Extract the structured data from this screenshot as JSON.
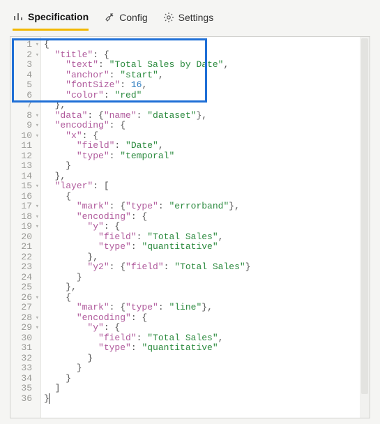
{
  "tabs": {
    "specification": "Specification",
    "config": "Config",
    "settings": "Settings",
    "activeIndex": 0
  },
  "gutter": {
    "count": 36,
    "foldLines": [
      1,
      2,
      8,
      9,
      10,
      15,
      17,
      18,
      19,
      26,
      28,
      29
    ]
  },
  "code": {
    "lines": [
      [
        {
          "t": "p",
          "v": "{"
        }
      ],
      [
        {
          "t": "sp",
          "v": "  "
        },
        {
          "t": "k",
          "v": "\"title\""
        },
        {
          "t": "p",
          "v": ": {"
        }
      ],
      [
        {
          "t": "sp",
          "v": "    "
        },
        {
          "t": "k",
          "v": "\"text\""
        },
        {
          "t": "p",
          "v": ": "
        },
        {
          "t": "s",
          "v": "\"Total Sales by Date\""
        },
        {
          "t": "p",
          "v": ","
        }
      ],
      [
        {
          "t": "sp",
          "v": "    "
        },
        {
          "t": "k",
          "v": "\"anchor\""
        },
        {
          "t": "p",
          "v": ": "
        },
        {
          "t": "s",
          "v": "\"start\""
        },
        {
          "t": "p",
          "v": ","
        }
      ],
      [
        {
          "t": "sp",
          "v": "    "
        },
        {
          "t": "k",
          "v": "\"fontSize\""
        },
        {
          "t": "p",
          "v": ": "
        },
        {
          "t": "n",
          "v": "16"
        },
        {
          "t": "p",
          "v": ","
        }
      ],
      [
        {
          "t": "sp",
          "v": "    "
        },
        {
          "t": "k",
          "v": "\"color\""
        },
        {
          "t": "p",
          "v": ": "
        },
        {
          "t": "s",
          "v": "\"red\""
        }
      ],
      [
        {
          "t": "sp",
          "v": "  "
        },
        {
          "t": "p",
          "v": "},"
        }
      ],
      [
        {
          "t": "sp",
          "v": "  "
        },
        {
          "t": "k",
          "v": "\"data\""
        },
        {
          "t": "p",
          "v": ": {"
        },
        {
          "t": "k",
          "v": "\"name\""
        },
        {
          "t": "p",
          "v": ": "
        },
        {
          "t": "s",
          "v": "\"dataset\""
        },
        {
          "t": "p",
          "v": "},"
        }
      ],
      [
        {
          "t": "sp",
          "v": "  "
        },
        {
          "t": "k",
          "v": "\"encoding\""
        },
        {
          "t": "p",
          "v": ": {"
        }
      ],
      [
        {
          "t": "sp",
          "v": "    "
        },
        {
          "t": "k",
          "v": "\"x\""
        },
        {
          "t": "p",
          "v": ": {"
        }
      ],
      [
        {
          "t": "sp",
          "v": "      "
        },
        {
          "t": "k",
          "v": "\"field\""
        },
        {
          "t": "p",
          "v": ": "
        },
        {
          "t": "s",
          "v": "\"Date\""
        },
        {
          "t": "p",
          "v": ","
        }
      ],
      [
        {
          "t": "sp",
          "v": "      "
        },
        {
          "t": "k",
          "v": "\"type\""
        },
        {
          "t": "p",
          "v": ": "
        },
        {
          "t": "s",
          "v": "\"temporal\""
        }
      ],
      [
        {
          "t": "sp",
          "v": "    "
        },
        {
          "t": "p",
          "v": "}"
        }
      ],
      [
        {
          "t": "sp",
          "v": "  "
        },
        {
          "t": "p",
          "v": "},"
        }
      ],
      [
        {
          "t": "sp",
          "v": "  "
        },
        {
          "t": "k",
          "v": "\"layer\""
        },
        {
          "t": "p",
          "v": ": ["
        }
      ],
      [
        {
          "t": "sp",
          "v": "    "
        },
        {
          "t": "p",
          "v": "{"
        }
      ],
      [
        {
          "t": "sp",
          "v": "      "
        },
        {
          "t": "k",
          "v": "\"mark\""
        },
        {
          "t": "p",
          "v": ": {"
        },
        {
          "t": "k",
          "v": "\"type\""
        },
        {
          "t": "p",
          "v": ": "
        },
        {
          "t": "s",
          "v": "\"errorband\""
        },
        {
          "t": "p",
          "v": "},"
        }
      ],
      [
        {
          "t": "sp",
          "v": "      "
        },
        {
          "t": "k",
          "v": "\"encoding\""
        },
        {
          "t": "p",
          "v": ": {"
        }
      ],
      [
        {
          "t": "sp",
          "v": "        "
        },
        {
          "t": "k",
          "v": "\"y\""
        },
        {
          "t": "p",
          "v": ": {"
        }
      ],
      [
        {
          "t": "sp",
          "v": "          "
        },
        {
          "t": "k",
          "v": "\"field\""
        },
        {
          "t": "p",
          "v": ": "
        },
        {
          "t": "s",
          "v": "\"Total Sales\""
        },
        {
          "t": "p",
          "v": ","
        }
      ],
      [
        {
          "t": "sp",
          "v": "          "
        },
        {
          "t": "k",
          "v": "\"type\""
        },
        {
          "t": "p",
          "v": ": "
        },
        {
          "t": "s",
          "v": "\"quantitative\""
        }
      ],
      [
        {
          "t": "sp",
          "v": "        "
        },
        {
          "t": "p",
          "v": "},"
        }
      ],
      [
        {
          "t": "sp",
          "v": "        "
        },
        {
          "t": "k",
          "v": "\"y2\""
        },
        {
          "t": "p",
          "v": ": {"
        },
        {
          "t": "k",
          "v": "\"field\""
        },
        {
          "t": "p",
          "v": ": "
        },
        {
          "t": "s",
          "v": "\"Total Sales\""
        },
        {
          "t": "p",
          "v": "}"
        }
      ],
      [
        {
          "t": "sp",
          "v": "      "
        },
        {
          "t": "p",
          "v": "}"
        }
      ],
      [
        {
          "t": "sp",
          "v": "    "
        },
        {
          "t": "p",
          "v": "},"
        }
      ],
      [
        {
          "t": "sp",
          "v": "    "
        },
        {
          "t": "p",
          "v": "{"
        }
      ],
      [
        {
          "t": "sp",
          "v": "      "
        },
        {
          "t": "k",
          "v": "\"mark\""
        },
        {
          "t": "p",
          "v": ": {"
        },
        {
          "t": "k",
          "v": "\"type\""
        },
        {
          "t": "p",
          "v": ": "
        },
        {
          "t": "s",
          "v": "\"line\""
        },
        {
          "t": "p",
          "v": "},"
        }
      ],
      [
        {
          "t": "sp",
          "v": "      "
        },
        {
          "t": "k",
          "v": "\"encoding\""
        },
        {
          "t": "p",
          "v": ": {"
        }
      ],
      [
        {
          "t": "sp",
          "v": "        "
        },
        {
          "t": "k",
          "v": "\"y\""
        },
        {
          "t": "p",
          "v": ": {"
        }
      ],
      [
        {
          "t": "sp",
          "v": "          "
        },
        {
          "t": "k",
          "v": "\"field\""
        },
        {
          "t": "p",
          "v": ": "
        },
        {
          "t": "s",
          "v": "\"Total Sales\""
        },
        {
          "t": "p",
          "v": ","
        }
      ],
      [
        {
          "t": "sp",
          "v": "          "
        },
        {
          "t": "k",
          "v": "\"type\""
        },
        {
          "t": "p",
          "v": ": "
        },
        {
          "t": "s",
          "v": "\"quantitative\""
        }
      ],
      [
        {
          "t": "sp",
          "v": "        "
        },
        {
          "t": "p",
          "v": "}"
        }
      ],
      [
        {
          "t": "sp",
          "v": "      "
        },
        {
          "t": "p",
          "v": "}"
        }
      ],
      [
        {
          "t": "sp",
          "v": "    "
        },
        {
          "t": "p",
          "v": "}"
        }
      ],
      [
        {
          "t": "sp",
          "v": "  "
        },
        {
          "t": "p",
          "v": "]"
        }
      ],
      [
        {
          "t": "p",
          "v": "}"
        },
        {
          "t": "cursor",
          "v": ""
        }
      ]
    ]
  },
  "highlight": {
    "enabled": true
  },
  "colors": {
    "accent": "#f2b800",
    "highlightBorder": "#1f6fd6",
    "key": "#b05a9c",
    "string": "#2b8a3e",
    "number": "#2a7bbf"
  }
}
